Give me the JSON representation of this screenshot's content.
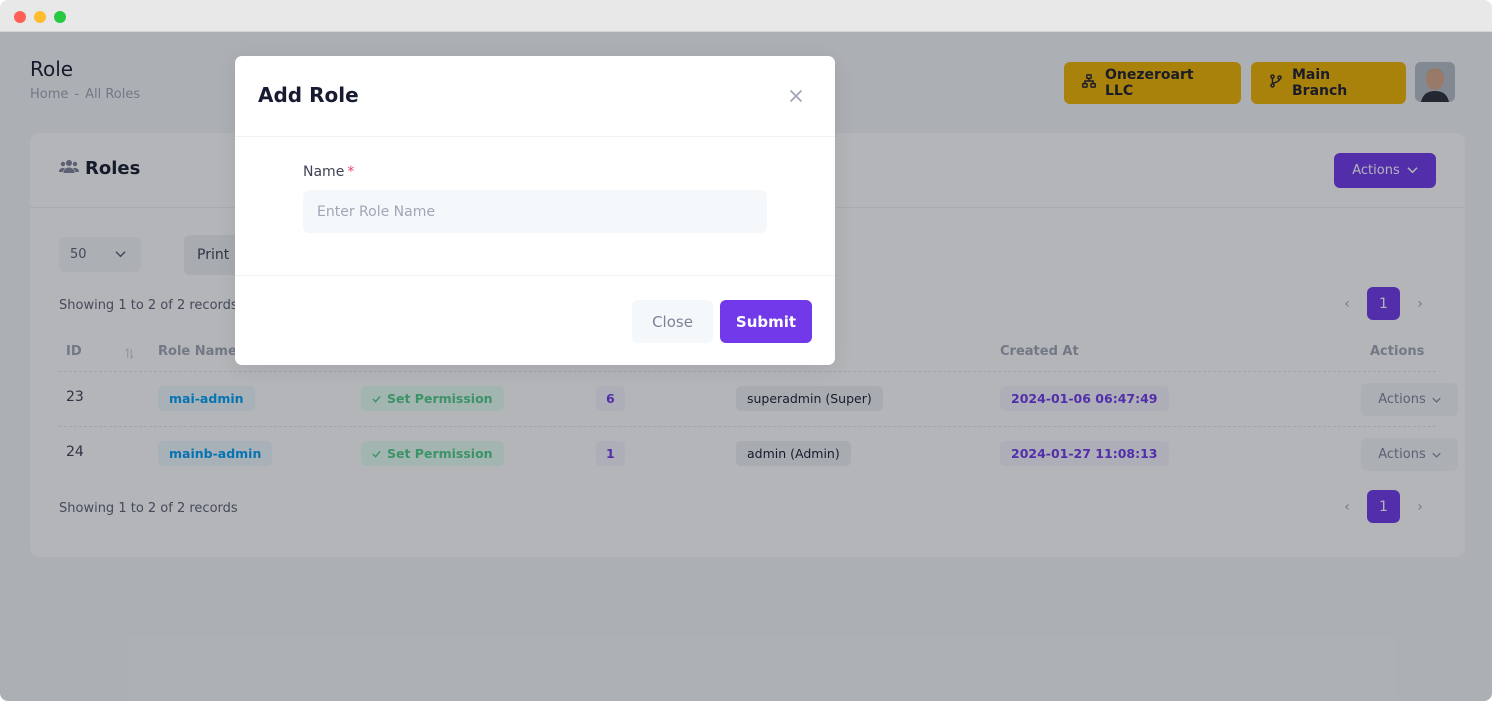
{
  "page": {
    "title": "Role",
    "breadcrumb": [
      "Home",
      "-",
      "All Roles"
    ]
  },
  "header": {
    "company_label": "Onezeroart LLC",
    "company_icon": "sitemap-icon",
    "branch_label": "Main Branch",
    "branch_icon": "code-branch-icon"
  },
  "card": {
    "title": "Roles",
    "title_icon": "users-icon",
    "actions_label": "Actions",
    "per_page": "50",
    "print_label": "Print",
    "records_text": "Showing 1 to 2 of 2 records",
    "pagination": {
      "current_page": "1",
      "prev": "‹",
      "next": "›"
    }
  },
  "table": {
    "headers": {
      "id": "ID",
      "role_name": "Role Name",
      "created_at": "Created At",
      "actions": "Actions"
    },
    "rows": [
      {
        "id": "23",
        "role_name": "mai-admin",
        "permission_label": "Set Permission",
        "count": "6",
        "created_by": "superadmin (Super)",
        "created_at": "2024-01-06 06:47:49",
        "actions_label": "Actions"
      },
      {
        "id": "24",
        "role_name": "mainb-admin",
        "permission_label": "Set Permission",
        "count": "1",
        "created_by": "admin (Admin)",
        "created_at": "2024-01-27 11:08:13",
        "actions_label": "Actions"
      }
    ]
  },
  "modal": {
    "title": "Add Role",
    "field_label": "Name",
    "required_mark": "*",
    "field_placeholder": "Enter Role Name",
    "field_value": "",
    "close_label": "Close",
    "submit_label": "Submit"
  },
  "colors": {
    "primary": "#7239ea",
    "header_button": "#f0b400",
    "role_pill_text": "#009ef7",
    "permission_pill_text": "#50cd89"
  }
}
